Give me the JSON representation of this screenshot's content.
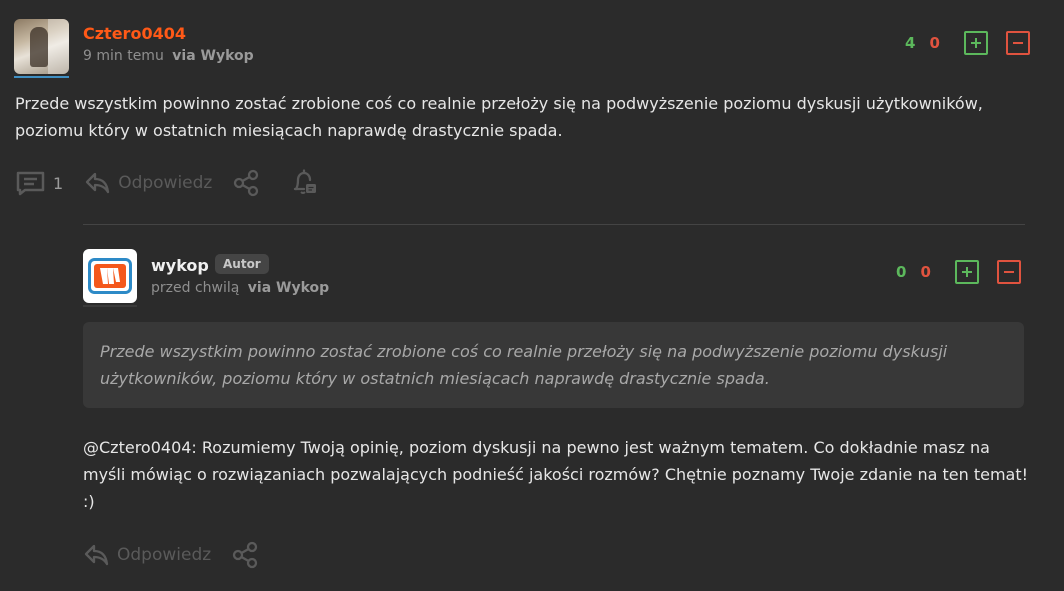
{
  "comment": {
    "username": "Cztero0404",
    "time": "9 min temu",
    "via": "via Wykop",
    "votes_plus": "4",
    "votes_minus": "0",
    "text": "Przede wszystkim powinno zostać zrobione coś co realnie przełoży się na podwyższenie poziomu dyskusji użytkowników, poziomu który w ostatnich miesiącach naprawdę drastycznie spada.",
    "actions": {
      "replies_count": "1",
      "reply_label": "Odpowiedz"
    }
  },
  "reply": {
    "username": "wykop",
    "badge": "Autor",
    "time": "przed chwilą",
    "via": "via Wykop",
    "votes_plus": "0",
    "votes_minus": "0",
    "quote": "Przede wszystkim powinno zostać zrobione coś co realnie przełoży się na podwyższenie poziomu dyskusji użytkowników, poziomu który w ostatnich miesiącach naprawdę drastycznie spada.",
    "mention": "@Cztero0404",
    "text": ": Rozumiemy Twoją opinię, poziom dyskusji na pewno jest ważnym tematem. Co dokładnie masz na myśli mówiąc o rozwiązaniach pozwalających podnieść jakości rozmów? Chętnie poznamy Twoje zdanie na ten temat! :)",
    "actions": {
      "reply_label": "Odpowiedz"
    }
  },
  "colors": {
    "username_orange": "#ff5917",
    "plus_green": "#5cb85c",
    "minus_red": "#e0533f",
    "background": "#2b2b2b"
  },
  "icons": [
    "comments-icon",
    "reply-icon",
    "share-icon",
    "notification-bell-icon",
    "plus-vote-icon",
    "minus-vote-icon",
    "wykop-logo"
  ]
}
